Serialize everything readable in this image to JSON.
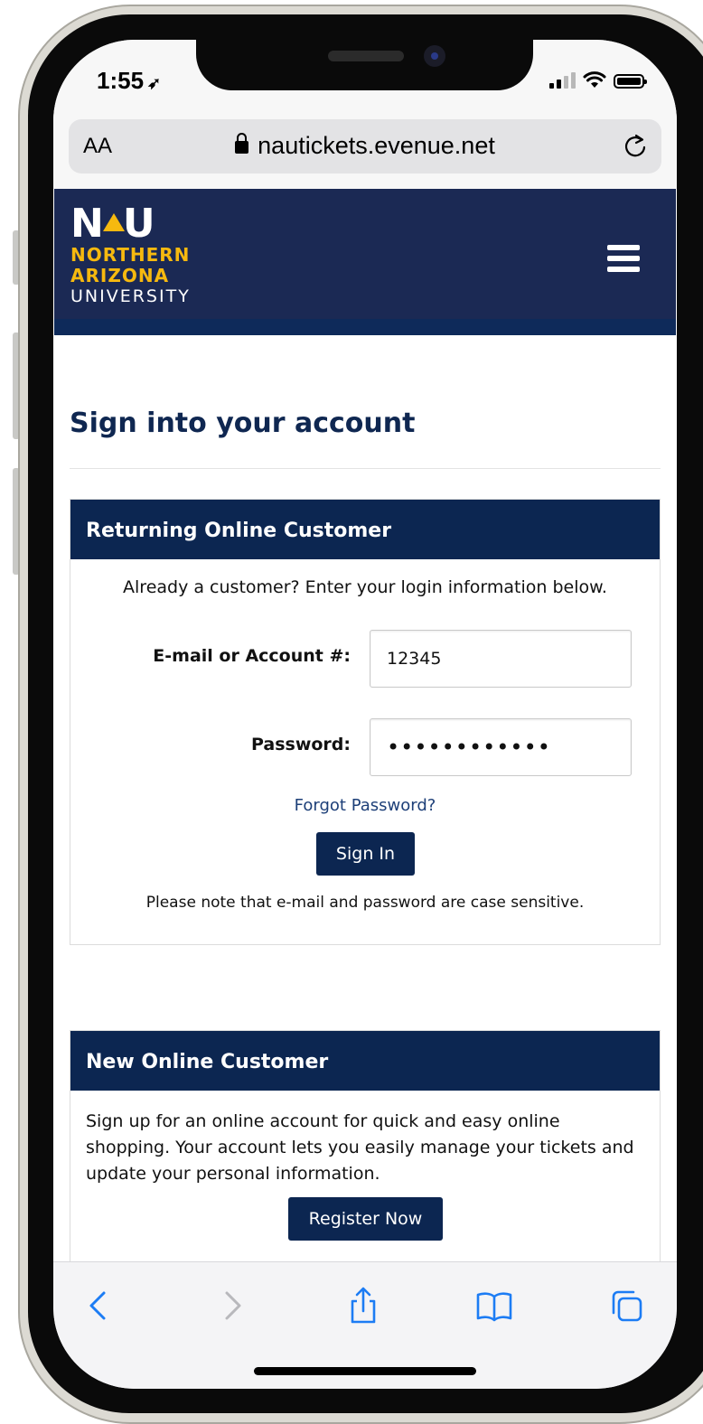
{
  "status_bar": {
    "time": "1:55",
    "location_arrow": "➶"
  },
  "browser": {
    "text_size_label": "AA",
    "url": "nautickets.evenue.net"
  },
  "site": {
    "logo": {
      "wordmark": "NAU",
      "line1": "NORTHERN",
      "line2": "ARIZONA",
      "line3": "UNIVERSITY"
    },
    "brand_colors": {
      "navy": "#0c2651",
      "gold": "#f6b90f"
    }
  },
  "page": {
    "title": "Sign into your account"
  },
  "returning": {
    "heading": "Returning Online Customer",
    "intro": "Already a customer? Enter your login information below.",
    "email_label": "E-mail or Account #:",
    "email_value": "12345",
    "password_label": "Password:",
    "password_value": "••••••••••••",
    "forgot_link": "Forgot Password?",
    "signin_button": "Sign In",
    "note": "Please note that e-mail and password are case sensitive."
  },
  "new_customer": {
    "heading": "New Online Customer",
    "description": "Sign up for an online account for quick and easy online shopping. Your account lets you easily manage your tickets and update your personal information.",
    "register_button": "Register Now"
  },
  "toolbar": {
    "icons": [
      "back-icon",
      "forward-icon",
      "share-icon",
      "bookmarks-icon",
      "tabs-icon"
    ],
    "accent_color": "#1c7cf4"
  }
}
